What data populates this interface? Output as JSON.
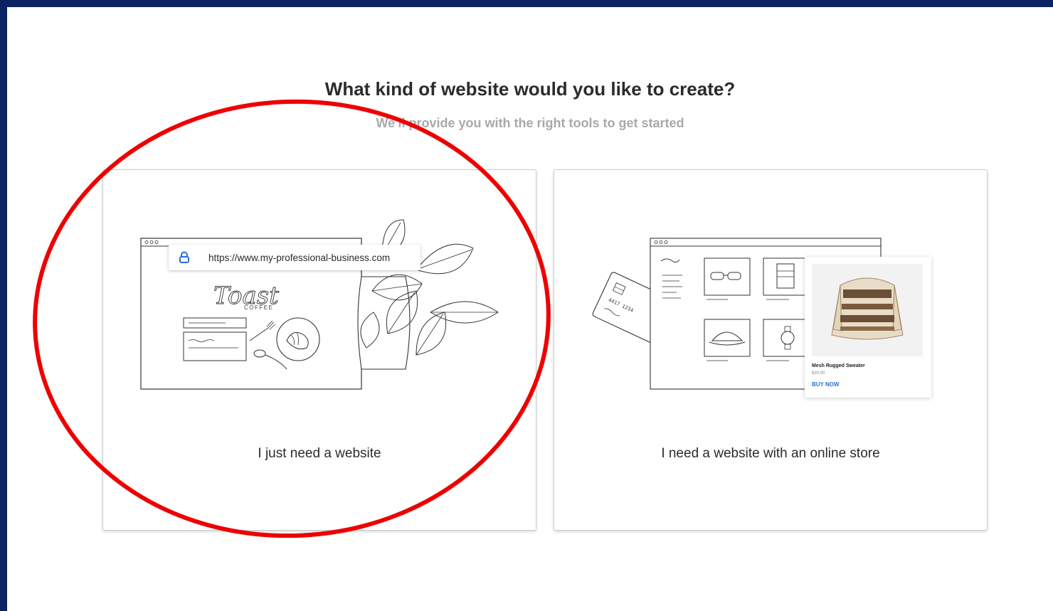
{
  "header": {
    "title": "What kind of website would you like to create?",
    "subtitle": "We'll provide you with the right tools to get started"
  },
  "options": [
    {
      "label": "I just need a website",
      "illustration": {
        "url": "https://www.my-professional-business.com",
        "logo_script": "Toast",
        "logo_sub": "COFFEE"
      }
    },
    {
      "label": "I need a website with an online store",
      "illustration": {
        "product_name": "Mesh Rugged Sweater",
        "product_price": "$20.00",
        "buy_label": "BUY NOW"
      }
    }
  ],
  "colors": {
    "frame": "#0b2363",
    "annotation": "#ee0000",
    "link": "#2c6fd8"
  },
  "annotation": {
    "shape": "ellipse",
    "target": "options.0"
  }
}
